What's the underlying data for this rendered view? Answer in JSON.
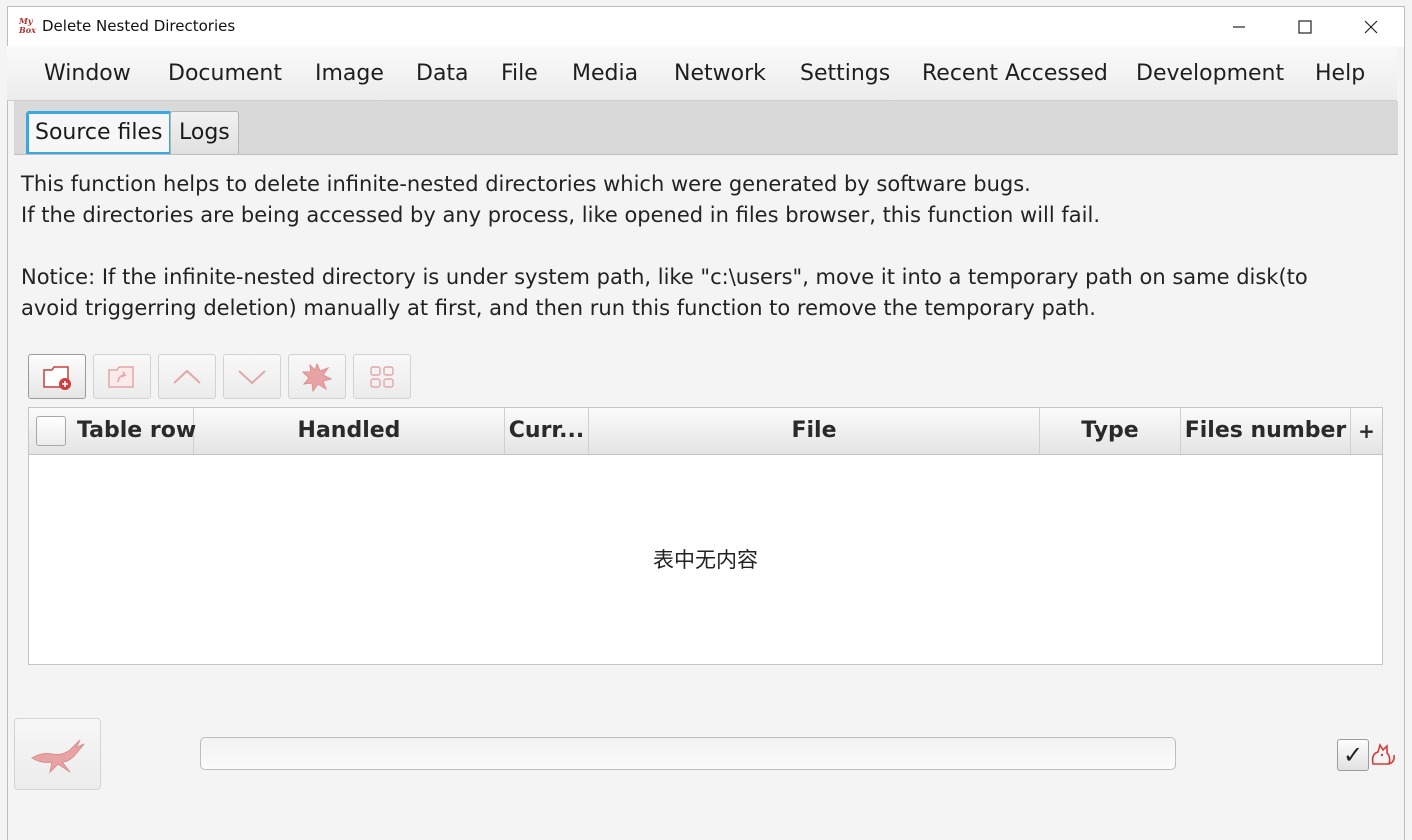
{
  "window": {
    "title": "Delete Nested Directories",
    "logo_text": "My Box",
    "controls": [
      "minimize",
      "maximize",
      "close"
    ]
  },
  "menu": [
    "Window",
    "Document",
    "Image",
    "Data",
    "File",
    "Media",
    "Network",
    "Settings",
    "Recent Accessed",
    "Development",
    "Help"
  ],
  "tabs": [
    {
      "label": "Source files",
      "active": true
    },
    {
      "label": "Logs",
      "active": false
    }
  ],
  "description": {
    "line1": "This function helps to delete infinite-nested directories which were generated by software bugs.",
    "line2": "If the directories are being accessed by any process, like opened in files browser, this function will fail.",
    "line3": "Notice: If the infinite-nested directory is under system path, like \"c:\\users\", move it into a temporary path on same disk(to",
    "line4": "avoid triggerring deletion) manually at first, and then run this function to remove the temporary path."
  },
  "toolbar": [
    {
      "icon": "add-folder-icon",
      "enabled": true
    },
    {
      "icon": "open-folder-icon",
      "enabled": false
    },
    {
      "icon": "move-up-icon",
      "enabled": false
    },
    {
      "icon": "move-down-icon",
      "enabled": false
    },
    {
      "icon": "delete-icon",
      "enabled": false
    },
    {
      "icon": "edit-icon",
      "enabled": false
    }
  ],
  "table": {
    "columns": [
      "Table row",
      "Handled",
      "Curr...",
      "File",
      "Type",
      "Files number"
    ],
    "add_column_label": "+",
    "empty_message": "表中无内容",
    "rows": []
  },
  "footer": {
    "start_icon": "start-icon",
    "progress": 0,
    "close_when_complete": true,
    "check_mark": "✓",
    "mascot_icon": "cat-icon"
  },
  "colors": {
    "accent": "#3ba7e0",
    "icon_red": "#c84040",
    "disabled_icon": "#e2a8a8"
  }
}
